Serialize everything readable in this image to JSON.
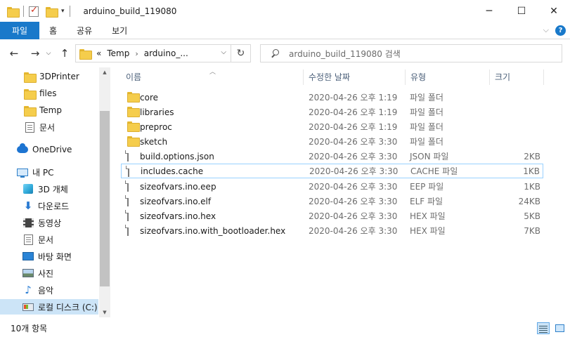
{
  "window": {
    "title": "arduino_build_119080",
    "controls": {
      "minimize": "─",
      "maximize": "☐",
      "close": "✕"
    }
  },
  "ribbon": {
    "tabs": [
      {
        "label": "파일",
        "active": true
      },
      {
        "label": "홈"
      },
      {
        "label": "공유"
      },
      {
        "label": "보기"
      }
    ],
    "help_label": "?"
  },
  "address": {
    "overflow": "«",
    "breadcrumbs": [
      "Temp",
      "arduino_..."
    ],
    "search_placeholder": "arduino_build_119080 검색"
  },
  "sidebar": {
    "items": [
      {
        "label": "3DPrinter",
        "icon": "folder-icon"
      },
      {
        "label": "files",
        "icon": "folder-icon"
      },
      {
        "label": "Temp",
        "icon": "folder-icon"
      },
      {
        "label": "문서",
        "icon": "documents-icon"
      },
      {
        "label": "OneDrive",
        "icon": "onedrive-icon"
      },
      {
        "label": "내 PC",
        "icon": "pc-icon"
      },
      {
        "label": "3D 개체",
        "icon": "3d-objects-icon"
      },
      {
        "label": "다운로드",
        "icon": "downloads-icon"
      },
      {
        "label": "동영상",
        "icon": "videos-icon"
      },
      {
        "label": "문서",
        "icon": "documents-icon"
      },
      {
        "label": "바탕 화면",
        "icon": "desktop-icon"
      },
      {
        "label": "사진",
        "icon": "pictures-icon"
      },
      {
        "label": "음악",
        "icon": "music-icon"
      },
      {
        "label": "로컬 디스크 (C:)",
        "icon": "local-disk-icon",
        "selected": true
      }
    ]
  },
  "columns": {
    "name": "이름",
    "date": "수정한 날짜",
    "type": "유형",
    "size": "크기"
  },
  "files": [
    {
      "name": "core",
      "date": "2020-04-26 오후 1:19",
      "type": "파일 폴더",
      "size": "",
      "icon": "folder-icon"
    },
    {
      "name": "libraries",
      "date": "2020-04-26 오후 1:19",
      "type": "파일 폴더",
      "size": "",
      "icon": "folder-icon"
    },
    {
      "name": "preproc",
      "date": "2020-04-26 오후 1:19",
      "type": "파일 폴더",
      "size": "",
      "icon": "folder-icon"
    },
    {
      "name": "sketch",
      "date": "2020-04-26 오후 3:30",
      "type": "파일 폴더",
      "size": "",
      "icon": "folder-icon"
    },
    {
      "name": "build.options.json",
      "date": "2020-04-26 오후 3:30",
      "type": "JSON 파일",
      "size": "2KB",
      "icon": "file-icon"
    },
    {
      "name": "includes.cache",
      "date": "2020-04-26 오후 3:30",
      "type": "CACHE 파일",
      "size": "1KB",
      "icon": "file-icon",
      "hovered": true
    },
    {
      "name": "sizeofvars.ino.eep",
      "date": "2020-04-26 오후 3:30",
      "type": "EEP 파일",
      "size": "1KB",
      "icon": "file-icon"
    },
    {
      "name": "sizeofvars.ino.elf",
      "date": "2020-04-26 오후 3:30",
      "type": "ELF 파일",
      "size": "24KB",
      "icon": "file-icon"
    },
    {
      "name": "sizeofvars.ino.hex",
      "date": "2020-04-26 오후 3:30",
      "type": "HEX 파일",
      "size": "5KB",
      "icon": "file-icon"
    },
    {
      "name": "sizeofvars.ino.with_bootloader.hex",
      "date": "2020-04-26 오후 3:30",
      "type": "HEX 파일",
      "size": "7KB",
      "icon": "file-icon"
    }
  ],
  "status": {
    "item_count": "10개 항목"
  },
  "colors": {
    "accent": "#1979ca",
    "selection": "#cce4f7",
    "hover_border": "#99d1ff",
    "folder": "#f5cd4c"
  }
}
